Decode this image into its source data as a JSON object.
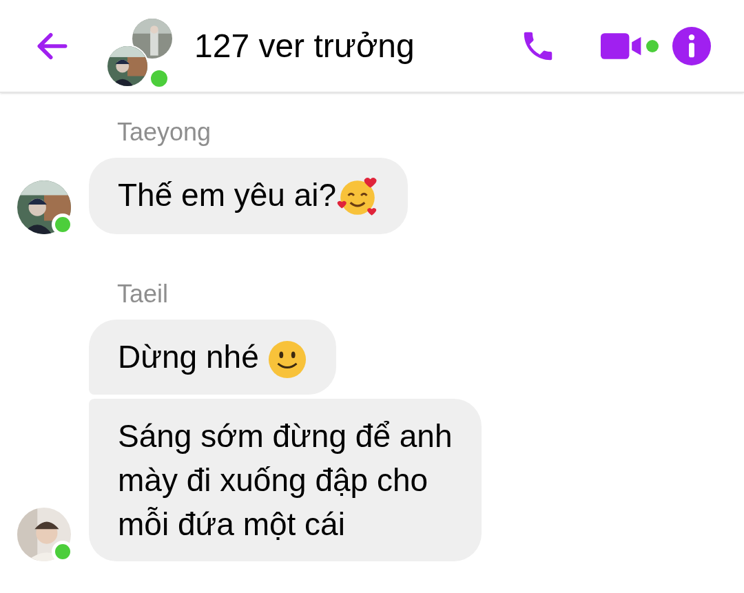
{
  "header": {
    "title": "127 ver trưởng",
    "online": true,
    "video_active": true
  },
  "groups": [
    {
      "sender": "Taeyong",
      "online": true,
      "messages": [
        {
          "lines": [
            "Thế em yêu ai?"
          ],
          "kind": "smiling_hearts"
        }
      ]
    },
    {
      "sender": "Taeil",
      "online": true,
      "messages": [
        {
          "lines": [
            "Dừng nhé"
          ],
          "kind": "smile"
        },
        {
          "lines": [
            "Sáng sớm đừng để anh",
            "mày đi xuống đập cho",
            "mỗi đứa một cái"
          ]
        }
      ]
    }
  ]
}
